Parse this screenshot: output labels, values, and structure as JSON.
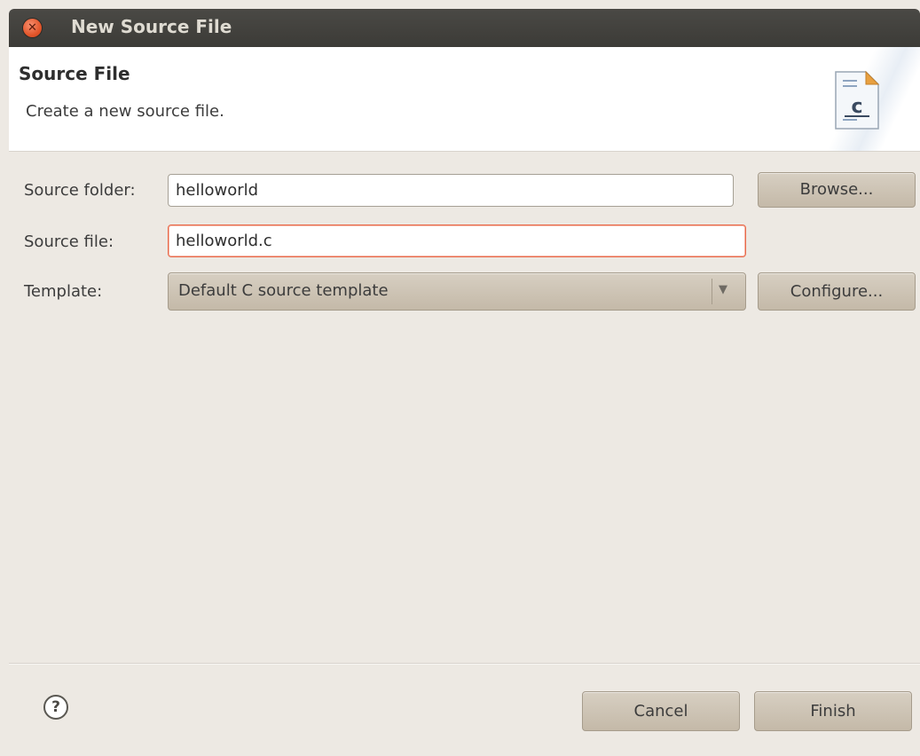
{
  "window": {
    "title": "New Source File"
  },
  "header": {
    "title": "Source File",
    "description": "Create a new source file.",
    "icon": "c-source-file-icon"
  },
  "form": {
    "source_folder": {
      "label": "Source folder:",
      "value": "helloworld",
      "button": "Browse..."
    },
    "source_file": {
      "label": "Source file:",
      "value": "helloworld.c"
    },
    "template": {
      "label": "Template:",
      "selected": "Default C source template",
      "button": "Configure..."
    }
  },
  "footer": {
    "cancel": "Cancel",
    "finish": "Finish",
    "help_symbol": "?"
  },
  "colors": {
    "titlebar": "#3c3b37",
    "background": "#ede9e3",
    "close": "#e3562b",
    "focus_border": "#e9694a"
  }
}
